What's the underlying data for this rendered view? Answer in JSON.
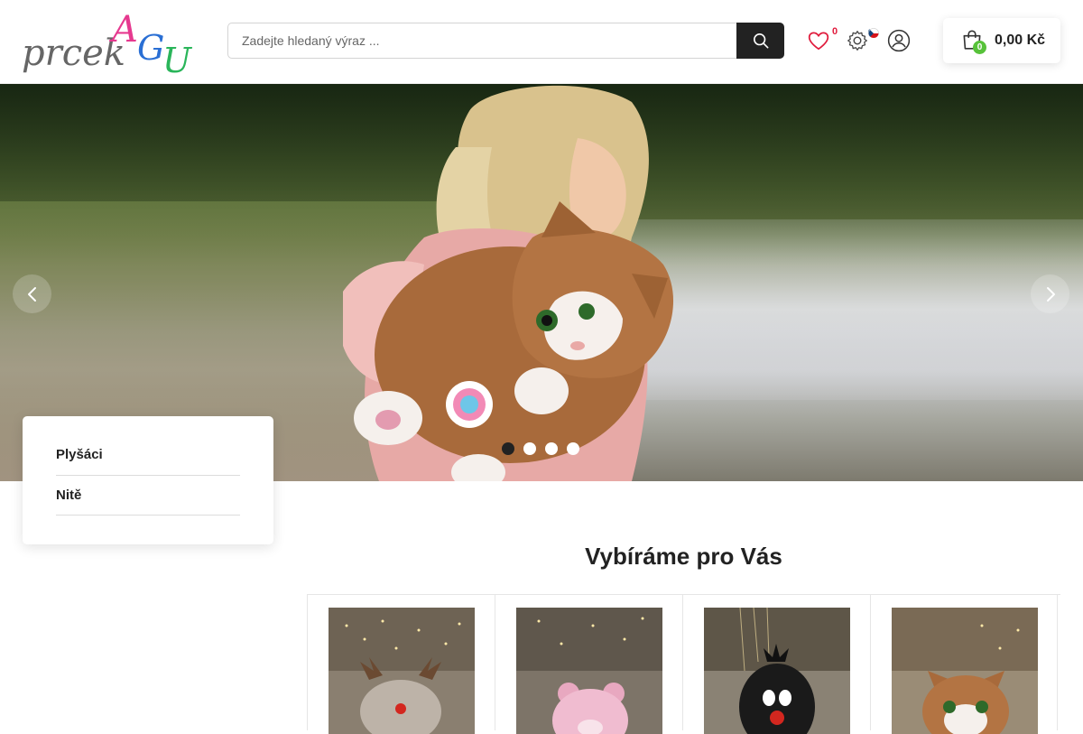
{
  "header": {
    "logo_text": "prcek AGU",
    "search": {
      "placeholder": "Zadejte hledaný výraz ..."
    },
    "wishlist_count": "0",
    "cart": {
      "count": "0",
      "total": "0,00 Kč"
    }
  },
  "hero": {
    "slides": 4,
    "active_slide": 1
  },
  "categories": [
    {
      "label": "Plyšáci"
    },
    {
      "label": "Nitě"
    }
  ],
  "section": {
    "title": "Vybíráme pro Vás"
  },
  "products": [
    {
      "image": "plush-reindeer"
    },
    {
      "image": "plush-pink-bear"
    },
    {
      "image": "plush-mole"
    },
    {
      "image": "plush-cat"
    }
  ],
  "colors": {
    "accent_dark": "#222222",
    "wishlist_red": "#e01b3c",
    "cart_badge_green": "#57c23a"
  }
}
